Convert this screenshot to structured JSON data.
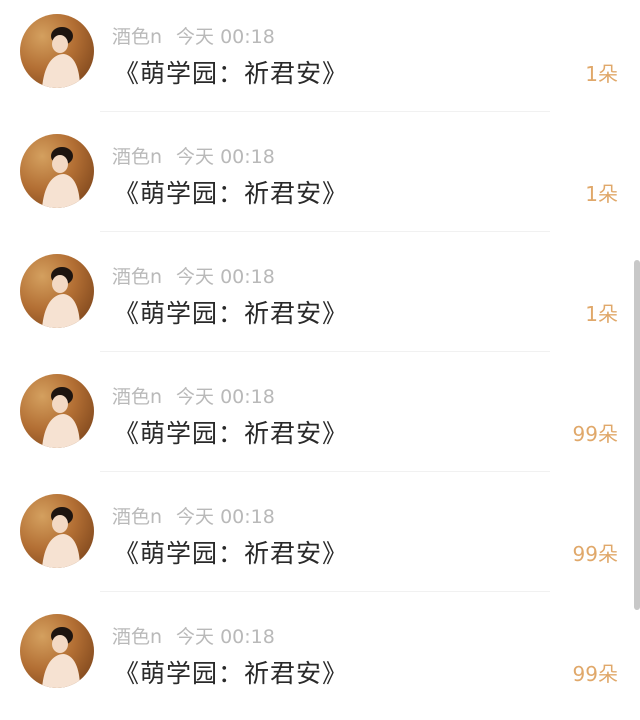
{
  "feed": {
    "items": [
      {
        "username": "酒色n",
        "time": "今天 00:18",
        "title": "《萌学园：祈君安》",
        "gift": "1朵"
      },
      {
        "username": "酒色n",
        "time": "今天 00:18",
        "title": "《萌学园：祈君安》",
        "gift": "1朵"
      },
      {
        "username": "酒色n",
        "time": "今天 00:18",
        "title": "《萌学园：祈君安》",
        "gift": "1朵"
      },
      {
        "username": "酒色n",
        "time": "今天 00:18",
        "title": "《萌学园：祈君安》",
        "gift": "99朵"
      },
      {
        "username": "酒色n",
        "time": "今天 00:18",
        "title": "《萌学园：祈君安》",
        "gift": "99朵"
      },
      {
        "username": "酒色n",
        "time": "今天 00:18",
        "title": "《萌学园：祈君安》",
        "gift": "99朵"
      }
    ]
  },
  "colors": {
    "meta": "#b9b9b9",
    "title": "#2a2a2a",
    "gift": "#e0a86a"
  }
}
